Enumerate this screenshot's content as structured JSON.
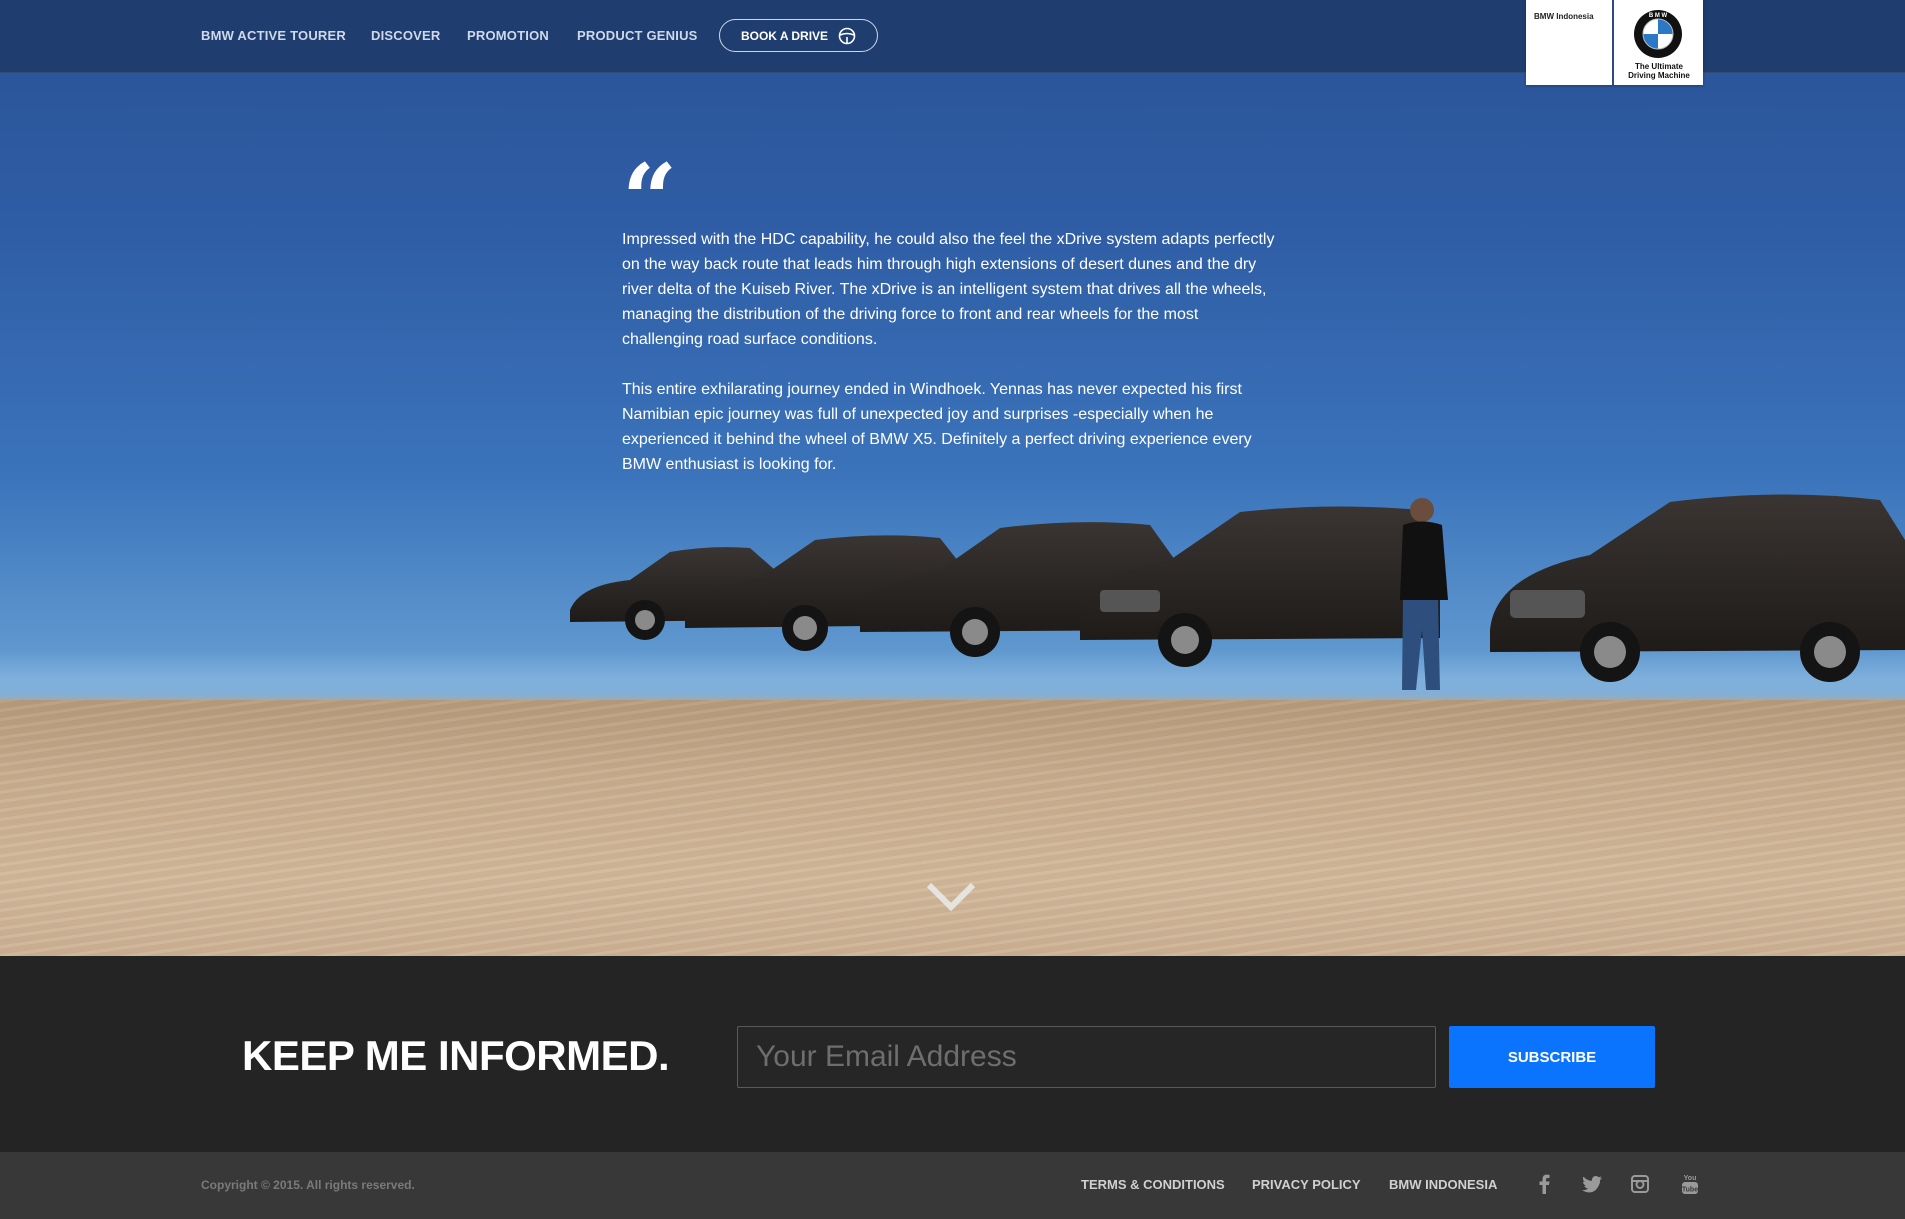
{
  "nav": {
    "items": [
      {
        "label": "BMW ACTIVE TOURER"
      },
      {
        "label": "DISCOVER"
      },
      {
        "label": "PROMOTION"
      },
      {
        "label": "PRODUCT GENIUS"
      }
    ],
    "book_label": "BOOK A DRIVE",
    "book_icon": "steering-wheel-icon"
  },
  "logo": {
    "region": "BMW Indonesia",
    "roundel_letters": "BMW",
    "tagline_line1": "The Ultimate",
    "tagline_line2": "Driving Machine"
  },
  "quote": {
    "mark": "“",
    "paragraphs": [
      "Impressed with the HDC capability, he could also the feel the xDrive system adapts perfectly on the way back route that leads him through high extensions of desert dunes and the dry river delta of the Kuiseb River. The xDrive is an intelligent system that drives all the wheels, managing the distribution of the driving force to front and rear wheels for the most challenging road surface conditions.",
      "This entire exhilarating journey ended in Windhoek. Yennas has never expected his first Namibian epic journey was full of unexpected joy and surprises -especially when he experienced it behind the wheel of BMW X5. Definitely a perfect driving experience every BMW enthusiast is looking for."
    ],
    "scroll_icon": "chevron-down-icon"
  },
  "newsletter": {
    "heading": "KEEP ME INFORMED.",
    "email_placeholder": "Your Email Address",
    "email_value": "",
    "subscribe_label": "SUBSCRIBE",
    "accent_color": "#0a74ff"
  },
  "footer": {
    "copyright": "Copyright © 2015. All rights reserved.",
    "links": [
      {
        "label": "TERMS & CONDITIONS"
      },
      {
        "label": "PRIVACY POLICY"
      },
      {
        "label": "BMW INDONESIA"
      }
    ],
    "social_icons": [
      "facebook-icon",
      "twitter-icon",
      "instagram-icon",
      "youtube-icon"
    ]
  },
  "colors": {
    "nav_bg": "#1f3d6e",
    "sky": "#2f5ea6",
    "sand": "#c9ae8e",
    "newsletter_bg": "#242424",
    "footer_bg": "#383838"
  }
}
